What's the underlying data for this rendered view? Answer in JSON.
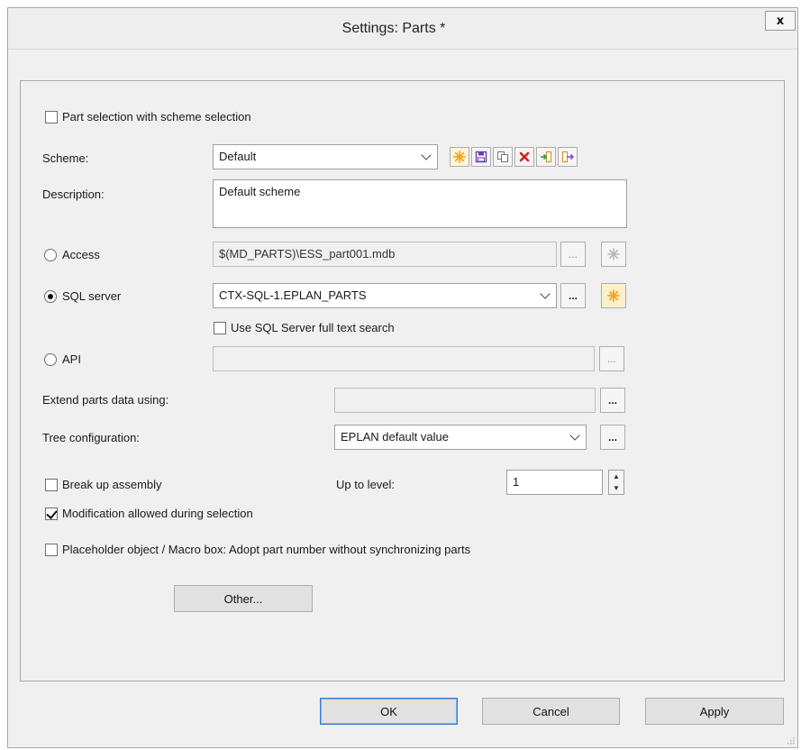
{
  "window": {
    "title": "Settings: Parts *",
    "close_label": "x"
  },
  "part_selection": {
    "label": "Part selection with scheme selection",
    "checked": false
  },
  "scheme": {
    "label": "Scheme:",
    "value": "Default",
    "toolbar_icons": [
      "new-icon",
      "save-icon",
      "copy-icon",
      "delete-icon",
      "import-icon",
      "export-icon"
    ]
  },
  "description": {
    "label": "Description:",
    "value": "Default scheme"
  },
  "access": {
    "label": "Access",
    "selected": false,
    "path": "$(MD_PARTS)\\ESS_part001.mdb",
    "browse_label": "..."
  },
  "sql_server": {
    "label": "SQL server",
    "selected": true,
    "value": "CTX-SQL-1.EPLAN_PARTS",
    "browse_label": "...",
    "fulltext_label": "Use SQL Server full text search",
    "fulltext_checked": false
  },
  "api": {
    "label": "API",
    "selected": false,
    "value": "",
    "browse_label": "..."
  },
  "extend": {
    "label": "Extend parts data using:",
    "value": "",
    "browse_label": "..."
  },
  "tree": {
    "label": "Tree configuration:",
    "value": "EPLAN default value",
    "browse_label": "..."
  },
  "break_up": {
    "label": "Break up assembly",
    "checked": false
  },
  "level": {
    "label": "Up to level:",
    "value": "1"
  },
  "modification": {
    "label": "Modification allowed during selection",
    "checked": true
  },
  "placeholder": {
    "label": "Placeholder object / Macro box: Adopt part number without synchronizing parts",
    "checked": false
  },
  "buttons": {
    "other": "Other...",
    "ok": "OK",
    "cancel": "Cancel",
    "apply": "Apply"
  },
  "colors": {
    "accent": "#3d7bcf",
    "delete_red": "#d42020",
    "star_orange": "#f2a51a"
  }
}
